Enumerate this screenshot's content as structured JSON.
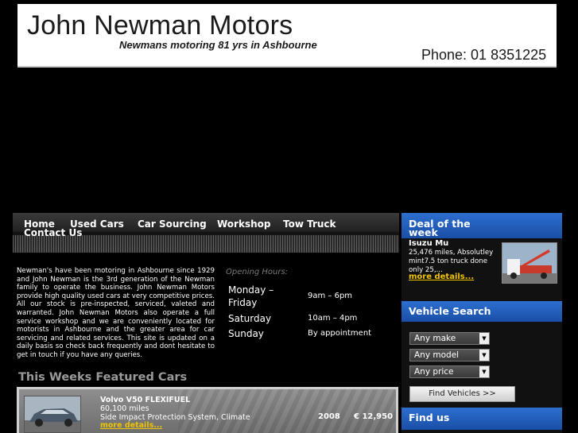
{
  "header": {
    "title": "John Newman Motors",
    "subtitle": "Newmans motoring 81 yrs in Ashbourne",
    "phone": "Phone: 01 8351225"
  },
  "nav": {
    "items": [
      "Home",
      "Used Cars",
      "Car Sourcing",
      "Workshop",
      "Tow Truck",
      "Contact Us"
    ]
  },
  "intro": {
    "text": "Newman's have been motoring in Ashbourne since 1929 and John Newman is the 3rd generation of the Newman family to operate the business. John Newman Motors provide high quality used cars at very competitive prices. All our stock is pre-inspected, serviced, valeted and warranted. John Newman Motors also operate a full service workshop and we are conveniently located for motorists in Ashbourne and the greater area for car servicing and related services. This site is updated on a daily basis so check back frequently and dont hesitate to get in touch if you have any queries."
  },
  "hours": {
    "title": "Opening Hours:",
    "rows": [
      {
        "day": "Monday – Friday",
        "time": "9am – 6pm"
      },
      {
        "day": "Saturday",
        "time": "10am – 4pm"
      },
      {
        "day": "Sunday",
        "time": "By appointment"
      }
    ]
  },
  "featured": {
    "title": "This Weeks Featured Cars",
    "car": {
      "name": "Volvo V50 FLEXIFUEL",
      "miles": "60,100 miles",
      "desc": "Side Impact Protection System, Climate",
      "more": "more details...",
      "year": "2008",
      "price": "€ 12,950"
    }
  },
  "deal": {
    "title": "Deal of the week",
    "car": "Isuzu Mu",
    "desc": "25,476 miles, Absolutley mint7.5 ton truck done only 25,...",
    "more": "more details..."
  },
  "search": {
    "title": "Vehicle Search",
    "make": "Any make",
    "model": "Any model",
    "price": "Any price",
    "button": "Find Vehicles >>"
  },
  "find_us": {
    "title": "Find us"
  },
  "colors": {
    "accent_blue": "#2d6fd0",
    "link_yellow": "#f0c400"
  }
}
